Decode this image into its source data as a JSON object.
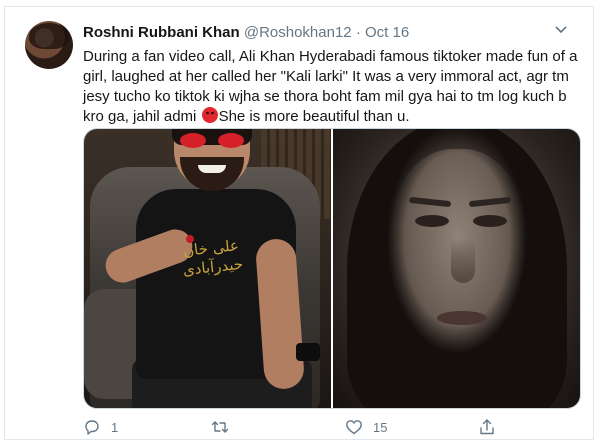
{
  "tweet": {
    "author_name": "Roshni Rubbani Khan",
    "handle": "@Roshokhan12",
    "separator": "·",
    "date": "Oct 16",
    "text_before_emoji": "During a fan video call, Ali Khan Hyderabadi famous tiktoker made fun of a girl, laughed at her called her \"Kali larki\" It was a very immoral act, agr tm jesy tucho ko tiktok ki wjha se thora boht fam mil gya hai to tm log kuch b kro ga, jahil admi ",
    "emoji": "angry-face-emoji",
    "text_after_emoji": "She is more beautiful than u.",
    "media": [
      {
        "name": "photo-man-in-chair",
        "shirt_text_line1": "علی خان",
        "shirt_text_line2": "حیدرآبادی"
      },
      {
        "name": "photo-girl-face"
      }
    ]
  },
  "actions": {
    "reply_count": "1",
    "retweet_count": "",
    "like_count": "15",
    "share_count": ""
  },
  "colors": {
    "text": "#14171a",
    "secondary": "#657786",
    "border": "#e1e8ed",
    "emoji_red": "#e0282e"
  }
}
